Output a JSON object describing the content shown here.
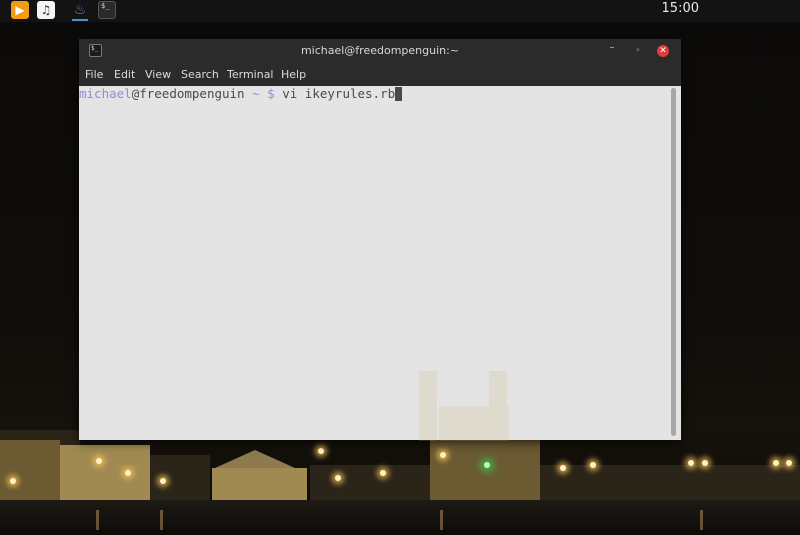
{
  "panel": {
    "clock": "15:00",
    "launchers": [
      {
        "name": "media-player-icon",
        "glyph": "▶"
      },
      {
        "name": "music-player-icon",
        "glyph": "♫"
      },
      {
        "name": "steam-icon",
        "glyph": "♨"
      },
      {
        "name": "terminal-launcher-icon",
        "glyph": "$_"
      }
    ]
  },
  "window": {
    "title": "michael@freedompenguin:~",
    "icon_glyph": "$_",
    "buttons": {
      "minimize": "–",
      "maximize": "◦",
      "close": "✕"
    },
    "menu": [
      "File",
      "Edit",
      "View",
      "Search",
      "Terminal",
      "Help"
    ]
  },
  "terminal": {
    "user": "michael",
    "at": "@",
    "host": "freedompenguin",
    "cwd": "~",
    "dollar": "$",
    "command": "vi ikeyrules.rb"
  },
  "colors": {
    "prompt_accent": "#8c8ed8",
    "terminal_bg": "#e4e4e4",
    "titlebar_bg": "#2b2b2b",
    "close_red": "#e2393b"
  }
}
